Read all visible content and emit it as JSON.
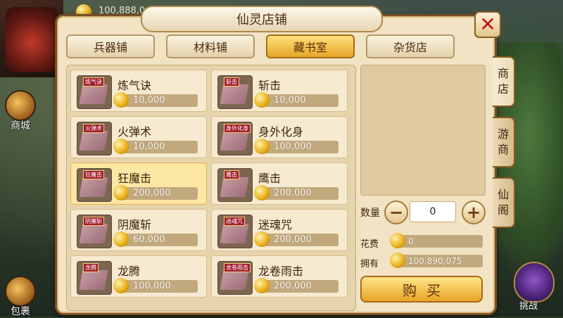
{
  "hud": {
    "gold_top": "100,888,0",
    "mall_label": "商城",
    "bag_label": "包裹",
    "challenge_label": "挑战"
  },
  "shop": {
    "title": "仙灵店铺",
    "tabs": [
      {
        "label": "兵器铺",
        "active": false
      },
      {
        "label": "材料铺",
        "active": false
      },
      {
        "label": "藏书室",
        "active": true
      },
      {
        "label": "杂货店",
        "active": false
      }
    ],
    "items": [
      {
        "name": "炼气诀",
        "tag": "炼气诀",
        "price": "10,000"
      },
      {
        "name": "斩击",
        "tag": "斩击",
        "price": "10,000"
      },
      {
        "name": "火弹术",
        "tag": "火弹术",
        "price": "10,000"
      },
      {
        "name": "身外化身",
        "tag": "身外化身",
        "price": "100,000"
      },
      {
        "name": "狂魔击",
        "tag": "狂魔击",
        "price": "200,000",
        "selected": true
      },
      {
        "name": "鹰击",
        "tag": "鹰击",
        "price": "200,000"
      },
      {
        "name": "阴魔斩",
        "tag": "阴魔斩",
        "price": "60,000"
      },
      {
        "name": "迷魂咒",
        "tag": "迷魂咒",
        "price": "200,000"
      },
      {
        "name": "龙腾",
        "tag": "龙腾",
        "price": "100,000"
      },
      {
        "name": "龙卷雨击",
        "tag": "龙卷雨击",
        "price": "200,000"
      }
    ],
    "quantity_label": "数量",
    "quantity_value": "0",
    "minus_symbol": "−",
    "plus_symbol": "+",
    "cost_label": "花费",
    "cost_value": "0",
    "own_label": "拥有",
    "own_value": "100,890,075",
    "buy_label": "购买",
    "close_symbol": "✕",
    "side_tabs": [
      {
        "label": "商店",
        "active": true
      },
      {
        "label": "游商",
        "active": false
      },
      {
        "label": "仙阁",
        "active": false
      }
    ]
  }
}
